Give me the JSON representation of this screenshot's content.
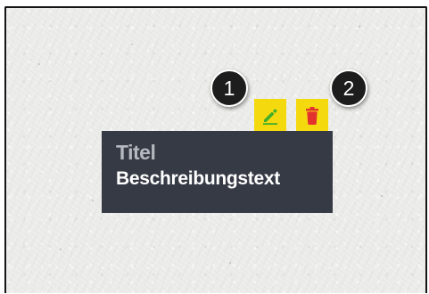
{
  "tooltip": {
    "title": "Titel",
    "description": "Beschreibungstext"
  },
  "actions": {
    "edit": {
      "icon": "pencil-icon",
      "background": "#f5d90f",
      "icon_color": "#3fae2a"
    },
    "delete": {
      "icon": "trash-icon",
      "background": "#f5d90f",
      "icon_color": "#e3312e"
    }
  },
  "badges": [
    {
      "label": "1"
    },
    {
      "label": "2"
    }
  ],
  "colors": {
    "tooltip_background": "#353a45",
    "badge_background": "#1d1d1d"
  }
}
